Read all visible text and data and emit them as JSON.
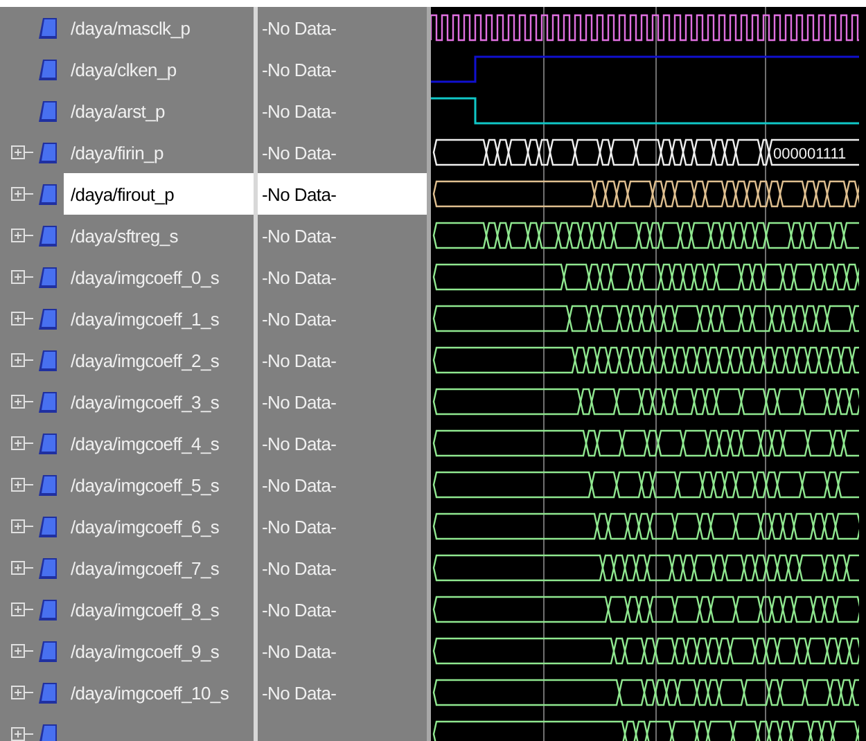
{
  "signals": [
    {
      "name": "/daya/masclk_p",
      "value": "-No Data-",
      "expandable": false,
      "selected": false,
      "wave": {
        "kind": "clock",
        "color": "#e070e0"
      }
    },
    {
      "name": "/daya/clken_p",
      "value": "-No Data-",
      "expandable": false,
      "selected": false,
      "wave": {
        "kind": "step_up",
        "color": "#1010d0"
      }
    },
    {
      "name": "/daya/arst_p",
      "value": "-No Data-",
      "expandable": false,
      "selected": false,
      "wave": {
        "kind": "step_down",
        "color": "#10c8c8"
      }
    },
    {
      "name": "/daya/firin_p",
      "value": "-No Data-",
      "expandable": true,
      "selected": false,
      "wave": {
        "kind": "bus",
        "color": "#f0f0f0",
        "label": "000001111"
      }
    },
    {
      "name": "/daya/firout_p",
      "value": "-No Data-",
      "expandable": true,
      "selected": true,
      "wave": {
        "kind": "bus",
        "color": "#e0c090"
      }
    },
    {
      "name": "/daya/sftreg_s",
      "value": "-No Data-",
      "expandable": true,
      "selected": false,
      "wave": {
        "kind": "bus",
        "color": "#90e890"
      }
    },
    {
      "name": "/daya/imgcoeff_0_s",
      "value": "-No Data-",
      "expandable": true,
      "selected": false,
      "wave": {
        "kind": "bus",
        "color": "#90e890"
      }
    },
    {
      "name": "/daya/imgcoeff_1_s",
      "value": "-No Data-",
      "expandable": true,
      "selected": false,
      "wave": {
        "kind": "bus",
        "color": "#90e890"
      }
    },
    {
      "name": "/daya/imgcoeff_2_s",
      "value": "-No Data-",
      "expandable": true,
      "selected": false,
      "wave": {
        "kind": "bus",
        "color": "#90e890"
      }
    },
    {
      "name": "/daya/imgcoeff_3_s",
      "value": "-No Data-",
      "expandable": true,
      "selected": false,
      "wave": {
        "kind": "bus",
        "color": "#90e890"
      }
    },
    {
      "name": "/daya/imgcoeff_4_s",
      "value": "-No Data-",
      "expandable": true,
      "selected": false,
      "wave": {
        "kind": "bus",
        "color": "#90e890"
      }
    },
    {
      "name": "/daya/imgcoeff_5_s",
      "value": "-No Data-",
      "expandable": true,
      "selected": false,
      "wave": {
        "kind": "bus",
        "color": "#90e890"
      }
    },
    {
      "name": "/daya/imgcoeff_6_s",
      "value": "-No Data-",
      "expandable": true,
      "selected": false,
      "wave": {
        "kind": "bus",
        "color": "#90e890"
      }
    },
    {
      "name": "/daya/imgcoeff_7_s",
      "value": "-No Data-",
      "expandable": true,
      "selected": false,
      "wave": {
        "kind": "bus",
        "color": "#90e890"
      }
    },
    {
      "name": "/daya/imgcoeff_8_s",
      "value": "-No Data-",
      "expandable": true,
      "selected": false,
      "wave": {
        "kind": "bus",
        "color": "#90e890"
      }
    },
    {
      "name": "/daya/imgcoeff_9_s",
      "value": "-No Data-",
      "expandable": true,
      "selected": false,
      "wave": {
        "kind": "bus",
        "color": "#90e890"
      }
    },
    {
      "name": "/daya/imgcoeff_10_s",
      "value": "-No Data-",
      "expandable": true,
      "selected": false,
      "wave": {
        "kind": "bus",
        "color": "#90e890"
      }
    },
    {
      "expandable": true,
      "selected": false,
      "wave": {
        "kind": "bus",
        "color": "#90e890"
      }
    }
  ]
}
